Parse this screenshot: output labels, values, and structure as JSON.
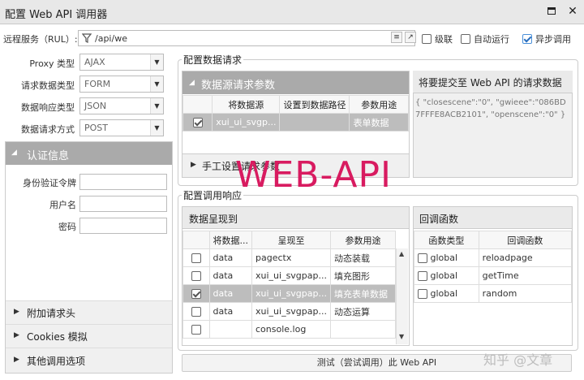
{
  "window": {
    "title": "配置 Web API 调用器"
  },
  "url_row": {
    "label": "远程服务（RUL）:",
    "url": "/api/we",
    "options": [
      {
        "label": "级联",
        "checked": false
      },
      {
        "label": "自动运行",
        "checked": false
      },
      {
        "label": "异步调用",
        "checked": true
      }
    ]
  },
  "left_form": {
    "fields": [
      {
        "label": "Proxy 类型",
        "value": "AJAX"
      },
      {
        "label": "请求数据类型",
        "value": "FORM"
      },
      {
        "label": "数据响应类型",
        "value": "JSON"
      },
      {
        "label": "数据请求方式",
        "value": "POST"
      }
    ],
    "auth": {
      "title": "认证信息",
      "fields": [
        {
          "label": "身份验证令牌",
          "value": ""
        },
        {
          "label": "用户名",
          "value": ""
        },
        {
          "label": "密码",
          "value": ""
        }
      ]
    },
    "sections": [
      "附加请求头",
      "Cookies 模拟",
      "其他调用选项"
    ]
  },
  "config_request": {
    "title": "配置数据请求",
    "source_params": {
      "title": "数据源请求参数",
      "columns": [
        "将数据源",
        "设置到数据路径",
        "参数用途"
      ],
      "rows": [
        {
          "checked": true,
          "source": "xui_ui_svgp...",
          "path": "",
          "usage": "表单数据"
        }
      ]
    },
    "manual_params": "手工设置请求参数",
    "preview": {
      "title": "将要提交至 Web API 的请求数据",
      "text": "{ \"closescene\":\"0\", \"gwieee\":\"086BD7FFFE8ACB2101\", \"openscene\":\"0\" }"
    }
  },
  "config_response": {
    "title": "配置调用响应",
    "present": {
      "title": "数据呈现到",
      "columns": [
        "将数据...",
        "呈现至",
        "参数用途"
      ],
      "rows": [
        {
          "checked": false,
          "data": "data",
          "target": "pagectx",
          "usage": "动态装载"
        },
        {
          "checked": false,
          "data": "data",
          "target": "xui_ui_svgpap...",
          "usage": "填充图形"
        },
        {
          "checked": true,
          "data": "data",
          "target": "xui_ui_svgpap...",
          "usage": "填充表单数据"
        },
        {
          "checked": false,
          "data": "data",
          "target": "xui_ui_svgpap...",
          "usage": "动态运算"
        },
        {
          "checked": false,
          "data": "",
          "target": "console.log",
          "usage": ""
        }
      ]
    },
    "callbacks": {
      "title": "回调函数",
      "columns": [
        "函数类型",
        "回调函数"
      ],
      "rows": [
        {
          "type": "global",
          "fn": "reloadpage"
        },
        {
          "type": "global",
          "fn": "getTime"
        },
        {
          "type": "global",
          "fn": "random"
        }
      ]
    }
  },
  "test_button": "测试（尝试调用）此 Web API",
  "watermark": "WEB-API",
  "corner_watermark": "知乎 @文章"
}
